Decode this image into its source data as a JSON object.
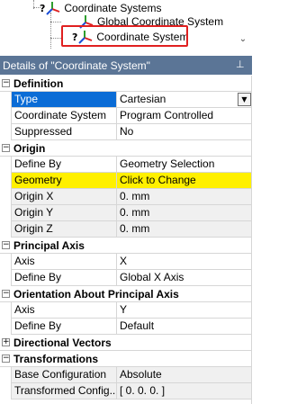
{
  "tree": {
    "items": [
      {
        "label": "Coordinate Systems",
        "expander": "−",
        "prefix": "?"
      },
      {
        "label": "Global Coordinate System",
        "prefix": ""
      },
      {
        "label": "Coordinate System",
        "prefix": "?"
      }
    ],
    "scroll_arrow": "⌄"
  },
  "details": {
    "title": "Details of \"Coordinate System\"",
    "pin": "⊥"
  },
  "sections": {
    "definition": {
      "title": "Definition",
      "toggle": "−",
      "type_name": "Type",
      "type_value": "Cartesian",
      "cs_name": "Coordinate System",
      "cs_value": "Program Controlled",
      "sup_name": "Suppressed",
      "sup_value": "No"
    },
    "origin": {
      "title": "Origin",
      "toggle": "−",
      "define_name": "Define By",
      "define_value": "Geometry Selection",
      "geom_name": "Geometry",
      "geom_value": "Click to Change",
      "x_name": "Origin X",
      "x_value": "0. mm",
      "y_name": "Origin Y",
      "y_value": "0. mm",
      "z_name": "Origin Z",
      "z_value": "0. mm"
    },
    "principal": {
      "title": "Principal Axis",
      "toggle": "−",
      "axis_name": "Axis",
      "axis_value": "X",
      "define_name": "Define By",
      "define_value": "Global X Axis"
    },
    "orientation": {
      "title": "Orientation About Principal Axis",
      "toggle": "−",
      "axis_name": "Axis",
      "axis_value": "Y",
      "define_name": "Define By",
      "define_value": "Default"
    },
    "directional": {
      "title": "Directional Vectors",
      "toggle": "+"
    },
    "transformations": {
      "title": "Transformations",
      "toggle": "−",
      "base_name": "Base Configuration",
      "base_value": "Absolute",
      "trans_name": "Transformed Config...",
      "trans_value": "[ 0. 0. 0. ]"
    }
  },
  "dropdown_arrow": "▼"
}
